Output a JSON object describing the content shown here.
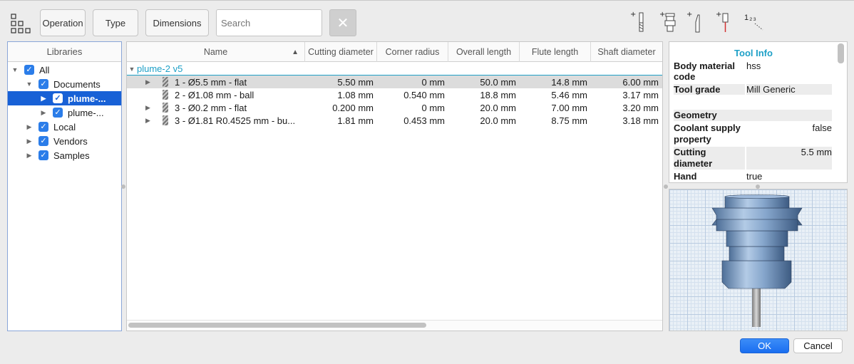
{
  "toolbar": {
    "operation_label": "Operation",
    "type_label": "Type",
    "dimensions_label": "Dimensions",
    "search_placeholder": "Search",
    "clear_label": "✕",
    "icons": [
      "grid-view-icon",
      "add-tool-icon",
      "add-holder-icon",
      "add-cutter-icon",
      "add-probe-icon",
      "renumber-icon"
    ],
    "renumber_glyph": "1₂₃"
  },
  "libraries": {
    "header": "Libraries",
    "items": [
      {
        "label": "All",
        "expanded": true,
        "checked": true
      },
      {
        "label": "Documents",
        "expanded": true,
        "checked": true
      },
      {
        "label": "plume-...",
        "expanded": false,
        "checked": true,
        "selected": true
      },
      {
        "label": "plume-...",
        "expanded": false,
        "checked": true
      },
      {
        "label": "Local",
        "expanded": false,
        "checked": true
      },
      {
        "label": "Vendors",
        "expanded": false,
        "checked": true
      },
      {
        "label": "Samples",
        "expanded": false,
        "checked": true
      }
    ]
  },
  "table": {
    "columns": [
      "Name",
      "Cutting diameter",
      "Corner radius",
      "Overall length",
      "Flute length",
      "Shaft diameter"
    ],
    "sort_indicator": "▲",
    "group_label": "plume-2 v5",
    "rows": [
      {
        "name": "1 - Ø5.5 mm - flat",
        "cutting_diameter": "5.50 mm",
        "corner_radius": "0 mm",
        "overall_length": "50.0 mm",
        "flute_length": "14.8 mm",
        "shaft_diameter": "6.00 mm",
        "selected": true,
        "expandable": true
      },
      {
        "name": "2 - Ø1.08 mm - ball",
        "cutting_diameter": "1.08 mm",
        "corner_radius": "0.540 mm",
        "overall_length": "18.8 mm",
        "flute_length": "5.46 mm",
        "shaft_diameter": "3.17 mm",
        "selected": false,
        "expandable": false
      },
      {
        "name": "3 - Ø0.2 mm - flat",
        "cutting_diameter": "0.200 mm",
        "corner_radius": "0 mm",
        "overall_length": "20.0 mm",
        "flute_length": "7.00 mm",
        "shaft_diameter": "3.20 mm",
        "selected": false,
        "expandable": true
      },
      {
        "name": "3 - Ø1.81 R0.4525 mm - bu...",
        "cutting_diameter": "1.81 mm",
        "corner_radius": "0.453 mm",
        "overall_length": "20.0 mm",
        "flute_length": "8.75 mm",
        "shaft_diameter": "3.18 mm",
        "selected": false,
        "expandable": true
      }
    ]
  },
  "tool_info": {
    "title": "Tool Info",
    "body_material_label": "Body material code",
    "body_material_value": "hss",
    "tool_grade_label": "Tool grade",
    "tool_grade_value": "Mill Generic",
    "geometry_label": "Geometry",
    "coolant_label": "Coolant supply property",
    "coolant_value": "false",
    "cutting_diameter_label": "Cutting diameter",
    "cutting_diameter_value": "5.5 mm",
    "hand_label": "Hand",
    "hand_value": "true"
  },
  "footer": {
    "ok_label": "OK",
    "cancel_label": "Cancel"
  },
  "colors": {
    "accent": "#1861d6",
    "link": "#1ea0c7",
    "checkbox": "#2b7de9"
  }
}
